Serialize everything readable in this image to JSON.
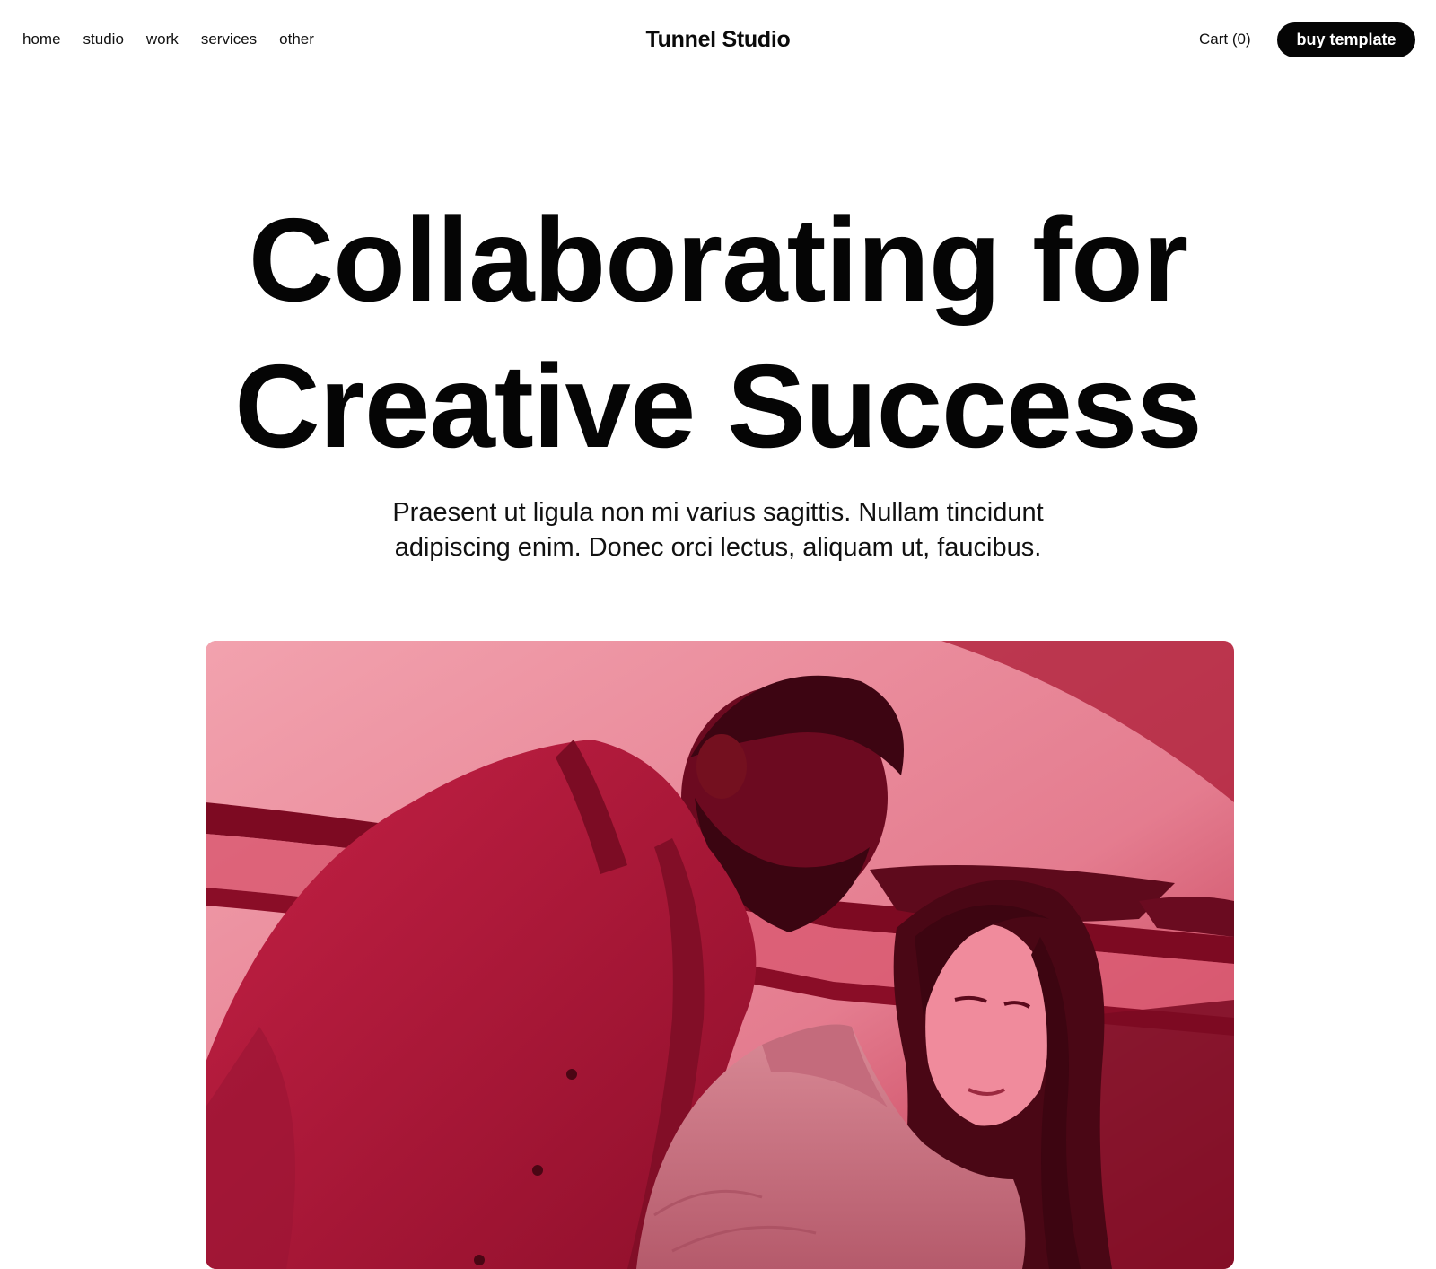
{
  "header": {
    "nav": [
      {
        "label": "home"
      },
      {
        "label": "studio"
      },
      {
        "label": "work"
      },
      {
        "label": "services"
      },
      {
        "label": "other"
      }
    ],
    "brand": "Tunnel Studio",
    "cart_label": "Cart",
    "cart_count": "(0)",
    "cta_label": "buy template"
  },
  "hero": {
    "title_line1": "Collaborating for",
    "title_line2": "Creative Success",
    "subtitle_line1": "Praesent ut ligula non mi varius sagittis. Nullam tincidunt",
    "subtitle_line2": "adipiscing enim. Donec orci lectus, aliquam ut, faucibus."
  },
  "image": {
    "description": "two-people-collaborating-photo",
    "tint_color": "#c8193e"
  },
  "colors": {
    "background": "#ffffff",
    "text": "#050505",
    "button_bg": "#050505",
    "button_text": "#ffffff"
  }
}
